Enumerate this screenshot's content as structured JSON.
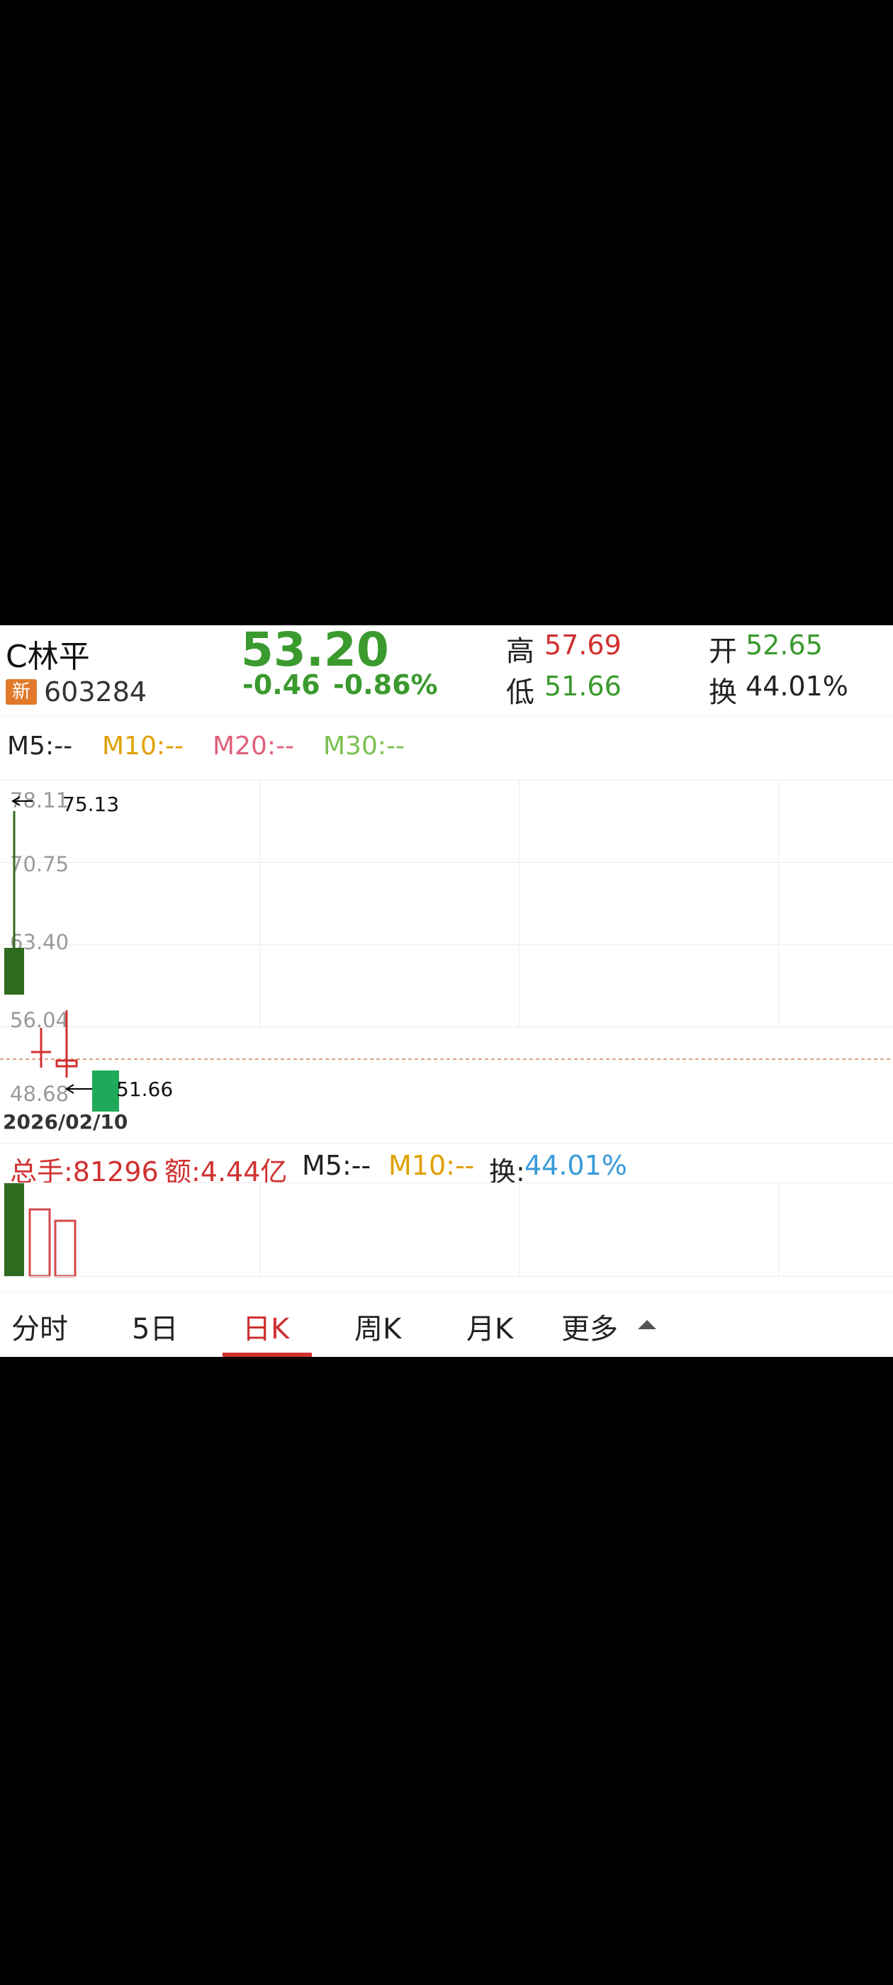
{
  "stock": {
    "name": "C林平",
    "badge": "新",
    "code": "603284",
    "price": "53.20",
    "change": "-0.46",
    "change_pct": "-0.86%",
    "high_label": "高",
    "high": "57.69",
    "low_label": "低",
    "low": "51.66",
    "open_label": "开",
    "open": "52.65",
    "turnover_label": "换",
    "turnover": "44.01%"
  },
  "ma": {
    "m5": "M5:--",
    "m10": "M10:--",
    "m20": "M20:--",
    "m30": "M30:--"
  },
  "chart": {
    "y_labels": [
      "78.11",
      "70.75",
      "63.40",
      "56.04",
      "48.68"
    ],
    "max_marker": "75.13",
    "min_marker": "51.66",
    "date_label": "2026/02/10"
  },
  "volume": {
    "total": "总手:81296",
    "amount": "额:4.44亿",
    "m5": "M5:--",
    "m10": "M10:--",
    "turnover_label": "换:",
    "turnover": "44.01%"
  },
  "tabs": [
    "分时",
    "5日",
    "日K",
    "周K",
    "月K",
    "更多"
  ],
  "active_tab": "日K",
  "colors": {
    "up": "#d03030",
    "down_dark": "#2f6b1f",
    "down": "#1faa5a",
    "price_green": "#3a9a2e",
    "m10": "#e0a000",
    "m20": "#e0607a",
    "m30": "#7ac050",
    "turnover_blue": "#3a9ad9"
  },
  "chart_data": {
    "type": "candlestick",
    "x_axis": [
      "2026/02/10",
      "",
      "",
      ""
    ],
    "y_ticks": [
      78.11,
      70.75,
      63.4,
      56.04,
      48.68
    ],
    "candles": [
      {
        "open": 62.5,
        "close": 58.5,
        "high": 75.13,
        "low": 58.5,
        "color": "down_dark"
      },
      {
        "open": 54.5,
        "close": 54.2,
        "high": 57.0,
        "low": 52.5,
        "color": "up"
      },
      {
        "open": 53.6,
        "close": 53.2,
        "high": 57.5,
        "low": 52.0,
        "color": "up"
      },
      {
        "open": 52.65,
        "close": 48.68,
        "high": 52.65,
        "low": 48.68,
        "color": "down"
      }
    ],
    "reference_price": 53.66,
    "volume_bars": [
      {
        "value": 1.0,
        "style": "filled-dark-green"
      },
      {
        "value": 0.7,
        "style": "hollow-red"
      },
      {
        "value": 0.58,
        "style": "hollow-red"
      }
    ]
  }
}
